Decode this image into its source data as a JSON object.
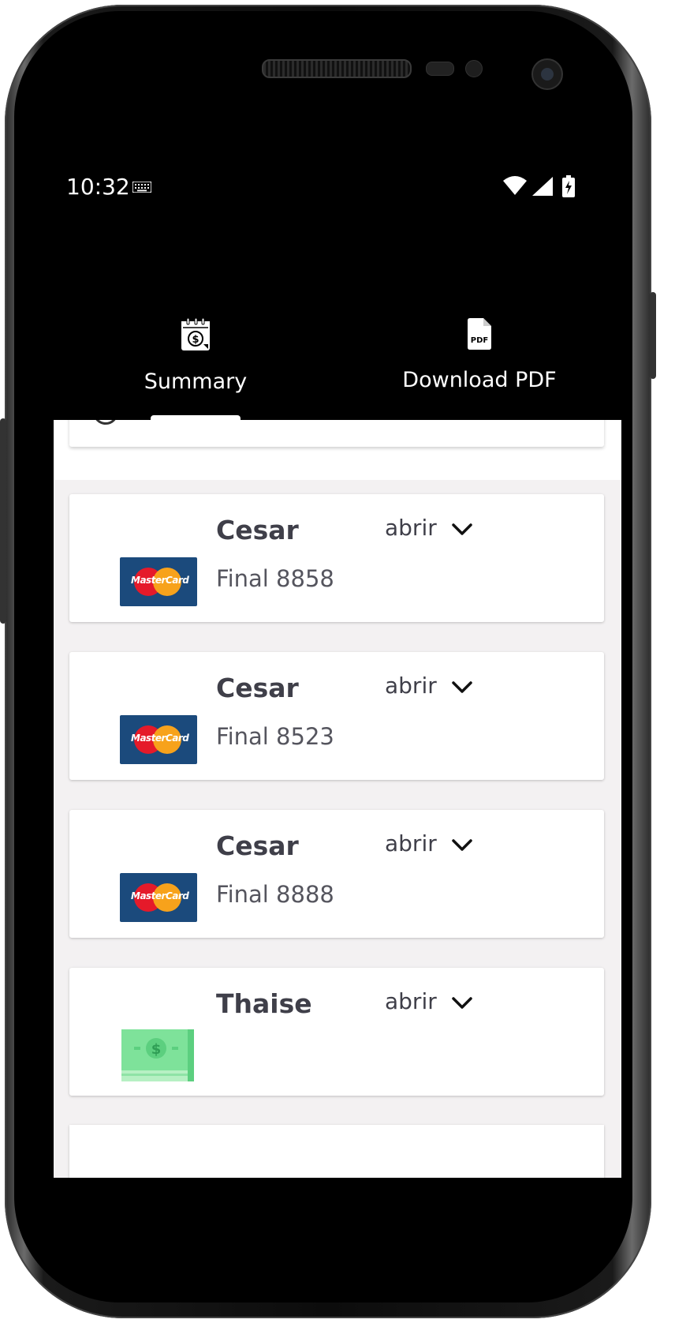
{
  "status_bar": {
    "time": "10:32"
  },
  "tabs": [
    {
      "label": "Summary",
      "icon": "calendar-dollar-icon",
      "active": true
    },
    {
      "label": "Download PDF",
      "icon": "pdf-file-icon",
      "active": false
    }
  ],
  "accounts": [
    {
      "name": "Cesar",
      "detail": "Final 8858",
      "action": "abrir",
      "logo": "mastercard-logo",
      "logo_text": "MasterCard"
    },
    {
      "name": "Cesar",
      "detail": "Final 8523",
      "action": "abrir",
      "logo": "mastercard-logo",
      "logo_text": "MasterCard"
    },
    {
      "name": "Cesar",
      "detail": "Final 8888",
      "action": "abrir",
      "logo": "mastercard-logo",
      "logo_text": "MasterCard"
    },
    {
      "name": "Thaise",
      "detail": "",
      "action": "abrir",
      "logo": "cash-icon"
    }
  ],
  "colors": {
    "background": "#f3f1f2",
    "card": "#ffffff",
    "text_dark": "#3f3f49",
    "mastercard_blue": "#1b4a7c",
    "mastercard_red": "#e51a2a",
    "mastercard_orange": "#f7a21b",
    "cash_green": "#7ee29a"
  }
}
